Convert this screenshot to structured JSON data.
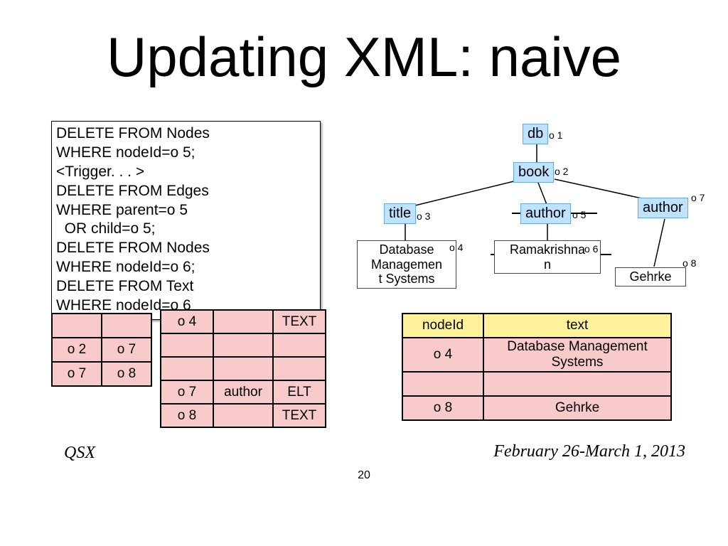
{
  "title": "Updating XML: naive",
  "sql": "DELETE FROM Nodes\nWHERE nodeId=o 5;\n<Trigger. . . >\nDELETE FROM Edges\nWHERE parent=o 5\n  OR child=o 5;\nDELETE FROM Nodes\nWHERE nodeId=o 6;\nDELETE FROM Text\nWHERE nodeId=o 6",
  "tree": {
    "db": {
      "label": "db",
      "id": "o 1"
    },
    "book": {
      "label": "book",
      "id": "o 2"
    },
    "title": {
      "label": "title",
      "id": "o 3"
    },
    "author1": {
      "label": "author",
      "id": "o 5"
    },
    "author2": {
      "label": "author",
      "id": "o 7"
    },
    "title_leaf": {
      "text": "Database\nManagemen\nt Systems",
      "id": "o 4"
    },
    "author1_leaf": {
      "text": "Ramakrishna\nn",
      "id": "o 6"
    },
    "author2_leaf": {
      "text": "Gehrke",
      "id": "o 8"
    }
  },
  "nodes_table": {
    "row_o4": {
      "id": "o 4",
      "tag": "",
      "kind": "TEXT"
    },
    "row_o7": {
      "id": "o 7",
      "tag": "author",
      "kind": "ELT"
    },
    "row_o8": {
      "id": "o 8",
      "tag": "",
      "kind": "TEXT"
    }
  },
  "edges_table": {
    "row_a": {
      "p": "o 2",
      "c": "o 7"
    },
    "row_b": {
      "p": "o 7",
      "c": "o 8"
    }
  },
  "text_table": {
    "header": {
      "id": "nodeId",
      "txt": "text"
    },
    "row_o4": {
      "id": "o 4",
      "txt": "Database Management Systems"
    },
    "row_o8": {
      "id": "o 8",
      "txt": "Gehrke"
    }
  },
  "footer": {
    "left": "QSX",
    "right": "February 26-March 1, 2013"
  },
  "pagenum": "20"
}
